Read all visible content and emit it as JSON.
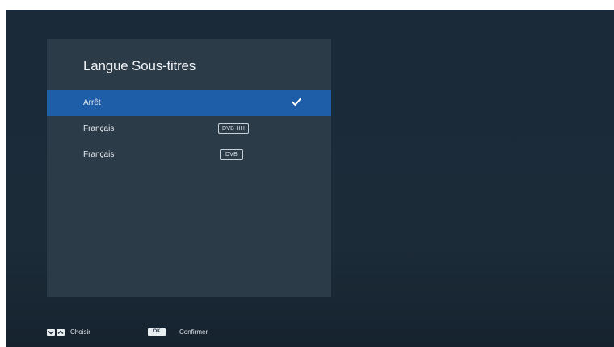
{
  "panel": {
    "title": "Langue Sous-titres"
  },
  "options": [
    {
      "label": "Arrêt",
      "badge": "",
      "selected": true
    },
    {
      "label": "Français",
      "badge": "DVB-HH",
      "selected": false
    },
    {
      "label": "Français",
      "badge": "DVB",
      "selected": false
    }
  ],
  "footer": {
    "navigate_label": "Choisir",
    "ok_key": "OK",
    "confirm_label": "Confirmer"
  },
  "colors": {
    "background": "#1c2b38",
    "panel": "#2c3b48",
    "selection": "#1e5ea8"
  },
  "icons": {
    "selected": "checkmark-icon",
    "down": "chevron-down-icon",
    "up": "chevron-up-icon"
  }
}
